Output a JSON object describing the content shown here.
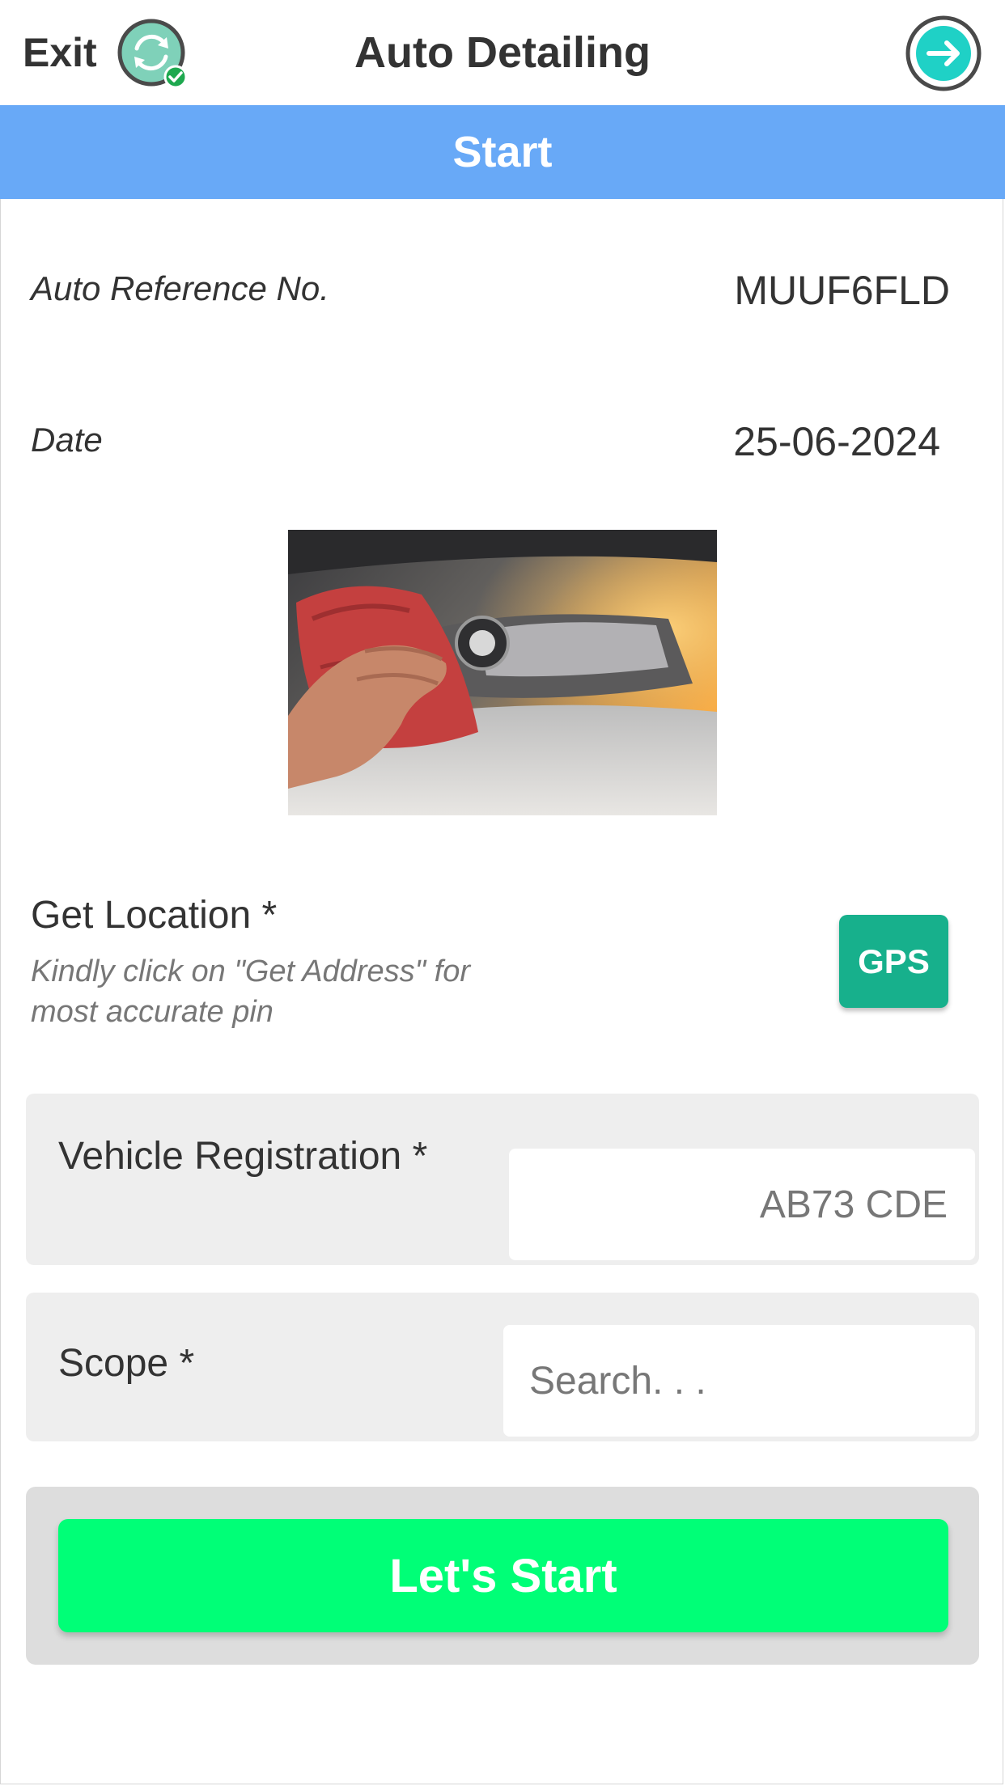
{
  "header": {
    "exit_label": "Exit",
    "title": "Auto Detailing",
    "sync_icon": "sync-check-icon",
    "next_icon": "arrow-right-circle-icon"
  },
  "banner": {
    "label": "Start"
  },
  "info": {
    "reference_label": "Auto Reference No.",
    "reference_value": "MUUF6FLD",
    "date_label": "Date",
    "date_value": "25-06-2024"
  },
  "location": {
    "title": "Get Location *",
    "hint": "Kindly click on \"Get Address\" for most accurate pin",
    "gps_label": "GPS"
  },
  "form": {
    "vehicle_label": "Vehicle Registration *",
    "vehicle_placeholder": "AB73 CDE",
    "scope_label": "Scope *",
    "scope_placeholder": "Search. . ."
  },
  "actions": {
    "start_label": "Let's Start"
  },
  "colors": {
    "banner": "#68a9f7",
    "gps": "#17b08c",
    "start": "#00ff77",
    "sync": "#7fd1b9",
    "next": "#1fd1c6"
  }
}
